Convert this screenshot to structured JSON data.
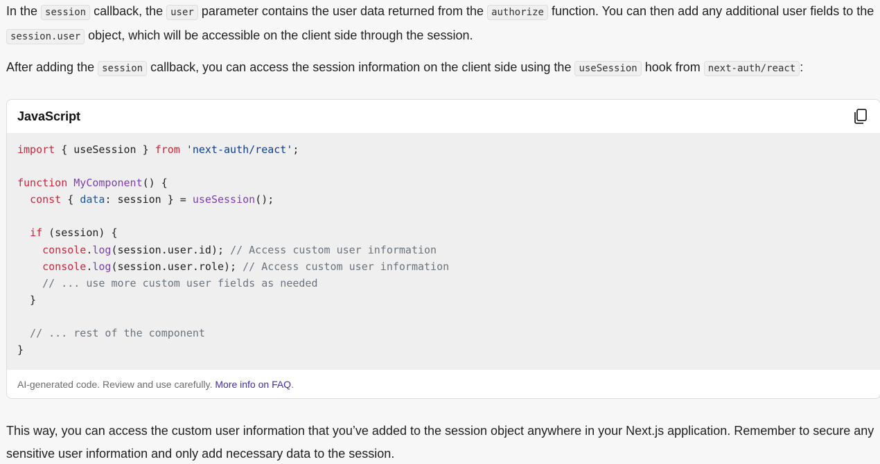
{
  "intro": {
    "p1": {
      "t1": "In the ",
      "c1": "session",
      "t2": " callback, the ",
      "c2": "user",
      "t3": " parameter contains the user data returned from the ",
      "c3": "authorize",
      "t4": " function. You can then add any additional user fields to the ",
      "c4": "session.user",
      "t5": " object, which will be accessible on the client side through the session."
    },
    "p2": {
      "t1": "After adding the ",
      "c1": "session",
      "t2": " callback, you can access the session information on the client side using the ",
      "c2": "useSession",
      "t3": " hook from ",
      "c3": "next-auth/react",
      "t4": ":"
    }
  },
  "code_block": {
    "language": "JavaScript",
    "copy_icon": "copy-icon",
    "lines": [
      "import { useSession } from 'next-auth/react';",
      "",
      "function MyComponent() {",
      "  const { data: session } = useSession();",
      "",
      "  if (session) {",
      "    console.log(session.user.id); // Access custom user information",
      "    console.log(session.user.role); // Access custom user information",
      "    // ... use more custom user fields as needed",
      "  }",
      "",
      "  // ... rest of the component",
      "}"
    ],
    "footer": {
      "note": "AI-generated code. Review and use carefully. ",
      "link": "More info on FAQ",
      "tail": "."
    }
  },
  "outro": {
    "text": "This way, you can access the custom user information that you’ve added to the session object anywhere in your Next.js application. Remember to secure any sensitive user information and only add necessary data to the session."
  },
  "colors": {
    "keyword": "#d1243b",
    "function": "#7b3fb3",
    "string": "#0b3d91",
    "comment": "#6a737d",
    "link": "#3c2ea0"
  }
}
